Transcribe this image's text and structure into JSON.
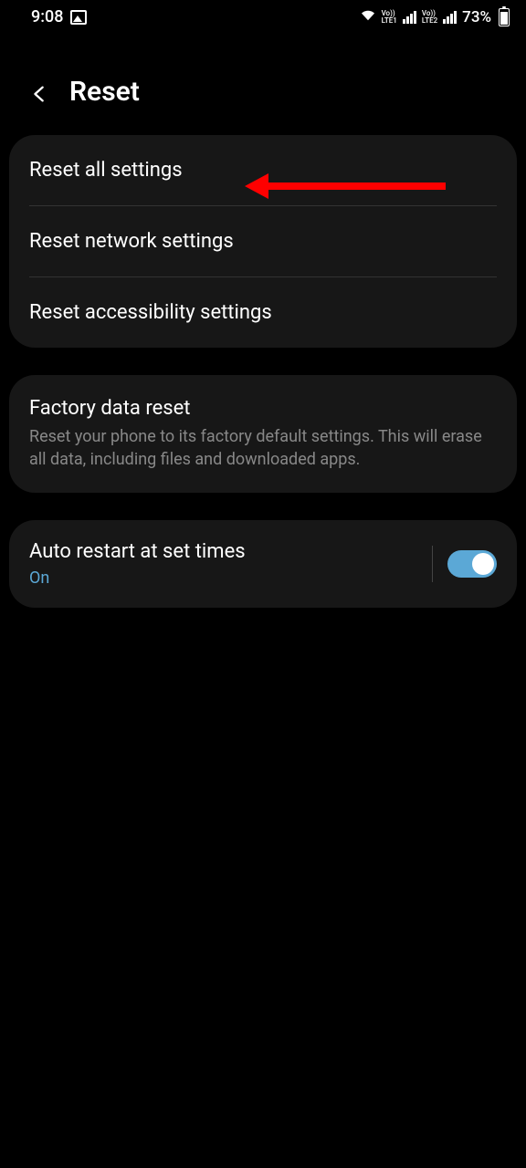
{
  "status_bar": {
    "time": "9:08",
    "battery_percent": "73%",
    "lte1_label": "LTE1",
    "lte2_label": "LTE2",
    "vo_label": "Vo))"
  },
  "header": {
    "title": "Reset"
  },
  "group1": {
    "item1": "Reset all settings",
    "item2": "Reset network settings",
    "item3": "Reset accessibility settings"
  },
  "group2": {
    "title": "Factory data reset",
    "subtitle": "Reset your phone to its factory default settings. This will erase all data, including files and downloaded apps."
  },
  "group3": {
    "title": "Auto restart at set times",
    "status": "On",
    "toggle_on": true
  }
}
